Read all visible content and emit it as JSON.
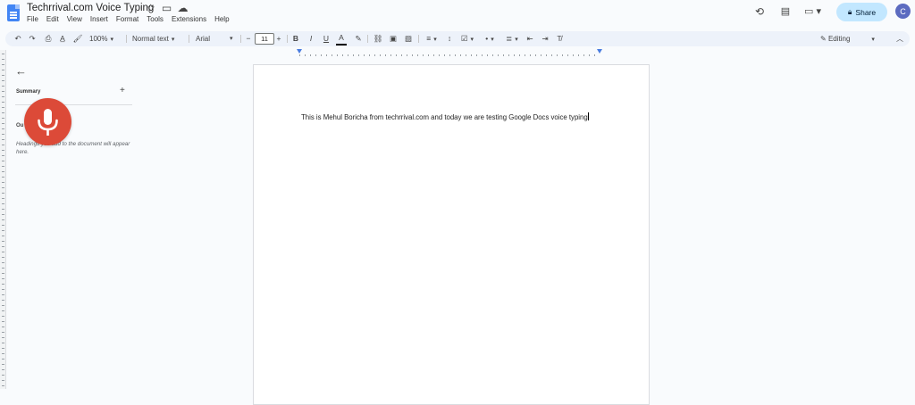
{
  "app": {
    "doc_title": "Techrrival.com Voice Typing",
    "menu": [
      "File",
      "Edit",
      "View",
      "Insert",
      "Format",
      "Tools",
      "Extensions",
      "Help"
    ],
    "share_label": "Share",
    "avatar_initial": "C"
  },
  "toolbar": {
    "zoom": "100%",
    "style": "Normal text",
    "font": "Arial",
    "font_size": "11",
    "bold": "B",
    "italic": "I",
    "underline": "U",
    "text_color": "A",
    "mode": "Editing"
  },
  "outline_panel": {
    "summary_label": "Summary",
    "outline_label": "Ou",
    "hint": "Headings you add to the document will appear here."
  },
  "document": {
    "body": "This is Mehul Boricha from techrrival.com and today we are testing Google Docs voice typing"
  },
  "colors": {
    "share_bg": "#c2e7ff",
    "toolbar_bg": "#edf2fa",
    "mic": "#dc4a38",
    "avatar": "#5c6bc0"
  }
}
